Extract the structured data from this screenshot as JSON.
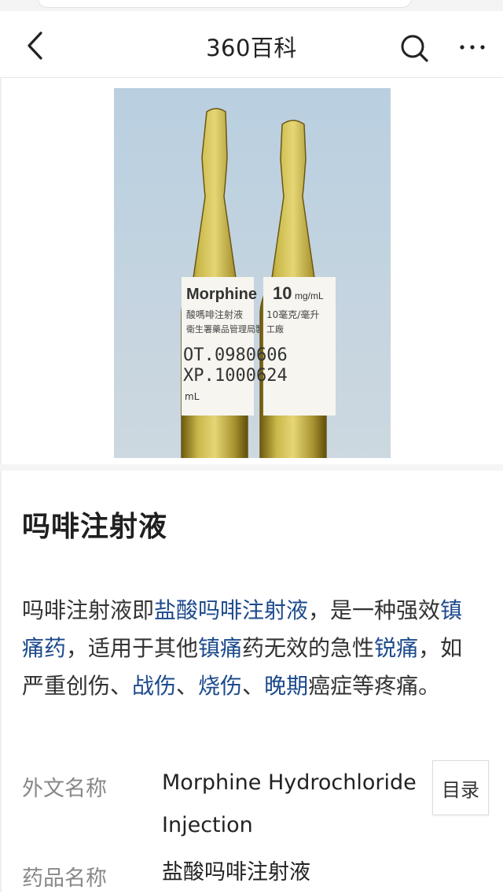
{
  "navbar": {
    "title": "360百科",
    "back_icon": "chevron-left-icon",
    "search_icon": "search-icon",
    "more_icon": "more-horizontal-icon"
  },
  "photo": {
    "label_left": {
      "brand": "Morphine",
      "line2": "酸嗎啡注射液",
      "line3": "衛生署藥品管理局製",
      "lot_label": "OT.",
      "exp_label": "XP.",
      "unit": "mL"
    },
    "label_right": {
      "dose": "10",
      "dose_unit": "mg/mL",
      "line2": "10毫克/毫升",
      "line3": "工廠",
      "lot": "0980606",
      "exp": "1000624"
    }
  },
  "entry": {
    "title": "吗啡注射液",
    "summary": [
      {
        "text": "吗啡注射液即",
        "link": false
      },
      {
        "text": "盐酸吗啡注射液",
        "link": true
      },
      {
        "text": "，是一种强效",
        "link": false
      },
      {
        "text": "镇痛药",
        "link": true
      },
      {
        "text": "，适用于其他",
        "link": false
      },
      {
        "text": "镇痛",
        "link": true
      },
      {
        "text": "药无效的急性",
        "link": false
      },
      {
        "text": "锐痛",
        "link": true
      },
      {
        "text": "，如严重创伤、",
        "link": false
      },
      {
        "text": "战伤",
        "link": true
      },
      {
        "text": "、",
        "link": false
      },
      {
        "text": "烧伤",
        "link": true
      },
      {
        "text": "、",
        "link": false
      },
      {
        "text": "晚期",
        "link": true
      },
      {
        "text": "癌症等疼痛。",
        "link": false
      }
    ]
  },
  "info": [
    {
      "label": "外文名称",
      "value": "Morphine Hydrochloride Injection"
    },
    {
      "label": "药品名称",
      "value": "盐酸吗啡注射液"
    }
  ],
  "toc_button": {
    "label": "目录"
  },
  "colors": {
    "link": "#1c4a8c",
    "label_gray": "#888888",
    "background": "#ffffff"
  }
}
